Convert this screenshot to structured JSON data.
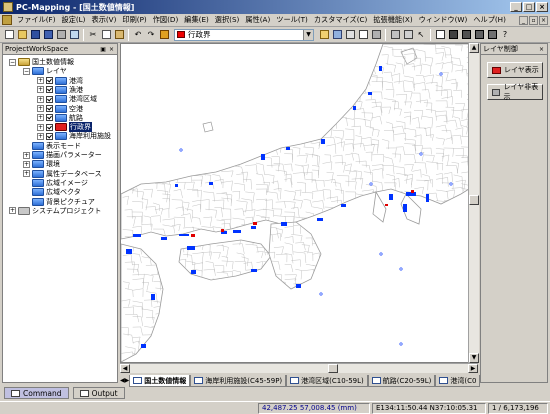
{
  "window": {
    "title": "PC-Mapping - [国土数値情報]"
  },
  "menu": {
    "items": [
      "ファイル(F)",
      "設定(L)",
      "表示(V)",
      "印刷(P)",
      "作図(D)",
      "編集(E)",
      "選択(S)",
      "属性(A)",
      "ツール(T)",
      "カスタマイズ(C)",
      "拡張機能(X)",
      "ウィンドウ(W)",
      "ヘルプ(H)"
    ]
  },
  "toolbar": {
    "layer_select_value": "行政界"
  },
  "left_pane": {
    "title": "ProjectWorkSpace",
    "tree": [
      {
        "label": "国土数値情報",
        "level": 1,
        "expander": "−",
        "icon": "yellow"
      },
      {
        "label": "レイヤ",
        "level": 2,
        "expander": "−",
        "icon": "blue"
      },
      {
        "label": "港湾",
        "level": 3,
        "expander": "+",
        "checked": true,
        "icon": "blue"
      },
      {
        "label": "漁港",
        "level": 3,
        "expander": "+",
        "checked": true,
        "icon": "blue"
      },
      {
        "label": "港湾区域",
        "level": 3,
        "expander": "+",
        "checked": true,
        "icon": "blue"
      },
      {
        "label": "空港",
        "level": 3,
        "expander": "+",
        "checked": true,
        "icon": "blue"
      },
      {
        "label": "航路",
        "level": 3,
        "expander": "+",
        "checked": true,
        "icon": "blue"
      },
      {
        "label": "行政界",
        "level": 3,
        "expander": "+",
        "checked": true,
        "icon": "red",
        "selected": true
      },
      {
        "label": "海岸利用施設",
        "level": 3,
        "expander": "+",
        "checked": true,
        "icon": "blue"
      },
      {
        "label": "表示モード",
        "level": 2,
        "expander": "",
        "icon": "blue"
      },
      {
        "label": "描画パラメーター",
        "level": 2,
        "expander": "+",
        "icon": "blue"
      },
      {
        "label": "環境",
        "level": 2,
        "expander": "+",
        "icon": "blue"
      },
      {
        "label": "属性データベース",
        "level": 2,
        "expander": "+",
        "icon": "blue"
      },
      {
        "label": "広域イメージ",
        "level": 2,
        "expander": "",
        "icon": "blue"
      },
      {
        "label": "広域ベクタ",
        "level": 2,
        "expander": "",
        "icon": "blue"
      },
      {
        "label": "背景ピクチュア",
        "level": 2,
        "expander": "",
        "icon": "blue"
      },
      {
        "label": "システムプロジェクト",
        "level": 1,
        "expander": "+",
        "icon": "gray"
      }
    ]
  },
  "right_pane": {
    "title": "レイヤ制御",
    "buttons": [
      "レイヤ表示",
      "レイヤ非表示"
    ]
  },
  "map_tabs": [
    {
      "label": "国土数値情報",
      "active": true
    },
    {
      "label": "海岸利用施設(C45-59P)",
      "active": false
    },
    {
      "label": "港湾区域(C10-59L)",
      "active": false
    },
    {
      "label": "航路(C20-59L)",
      "active": false
    },
    {
      "label": "港湾(C0",
      "active": false
    }
  ],
  "bottom_tabs": [
    {
      "label": "Command",
      "active": true
    },
    {
      "label": "Output",
      "active": false
    }
  ],
  "status": {
    "coords_mm": "42,487.25 57,008.45 (mm)",
    "latlon": "E134:11:50.44 N37:10:05.31",
    "count": "1 / 6,173,196"
  },
  "colors": {
    "boundary": "#9a9a9a",
    "coast_blue": "#0033ff",
    "highlight_red": "#e00000",
    "title_gradient_start": "#0a246a"
  }
}
